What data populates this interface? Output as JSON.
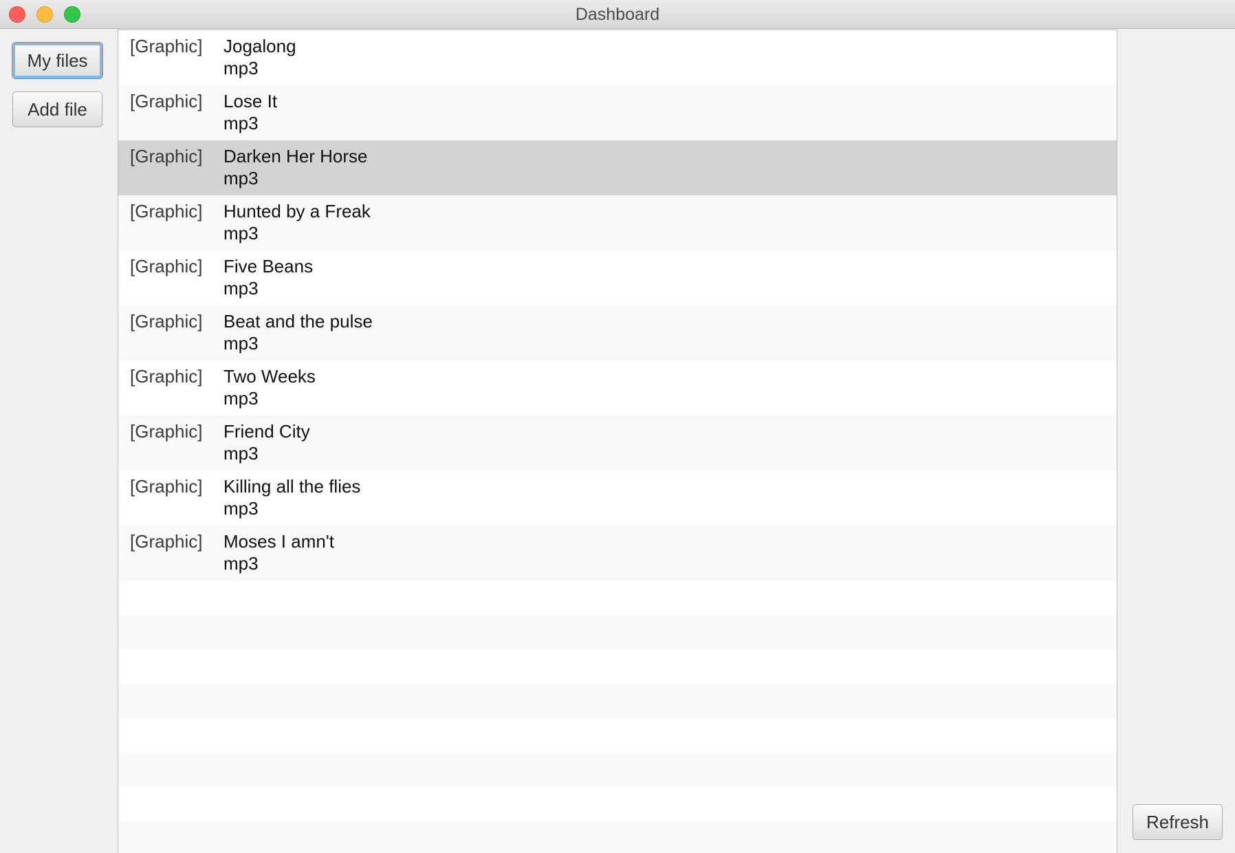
{
  "window": {
    "title": "Dashboard"
  },
  "sidebar": {
    "my_files_label": "My files",
    "add_file_label": "Add file"
  },
  "files": [
    {
      "graphic": "[Graphic]",
      "name": "Jogalong",
      "type": "mp3",
      "selected": false
    },
    {
      "graphic": "[Graphic]",
      "name": "Lose It",
      "type": "mp3",
      "selected": false
    },
    {
      "graphic": "[Graphic]",
      "name": "Darken Her Horse",
      "type": "mp3",
      "selected": true
    },
    {
      "graphic": "[Graphic]",
      "name": "Hunted by a Freak",
      "type": "mp3",
      "selected": false
    },
    {
      "graphic": "[Graphic]",
      "name": "Five Beans",
      "type": "mp3",
      "selected": false
    },
    {
      "graphic": "[Graphic]",
      "name": "Beat and the pulse",
      "type": "mp3",
      "selected": false
    },
    {
      "graphic": "[Graphic]",
      "name": "Two Weeks",
      "type": "mp3",
      "selected": false
    },
    {
      "graphic": "[Graphic]",
      "name": "Friend City",
      "type": "mp3",
      "selected": false
    },
    {
      "graphic": "[Graphic]",
      "name": "Killing all the flies",
      "type": "mp3",
      "selected": false
    },
    {
      "graphic": "[Graphic]",
      "name": "Moses I amn't",
      "type": "mp3",
      "selected": false
    }
  ],
  "actions": {
    "refresh_label": "Refresh"
  }
}
